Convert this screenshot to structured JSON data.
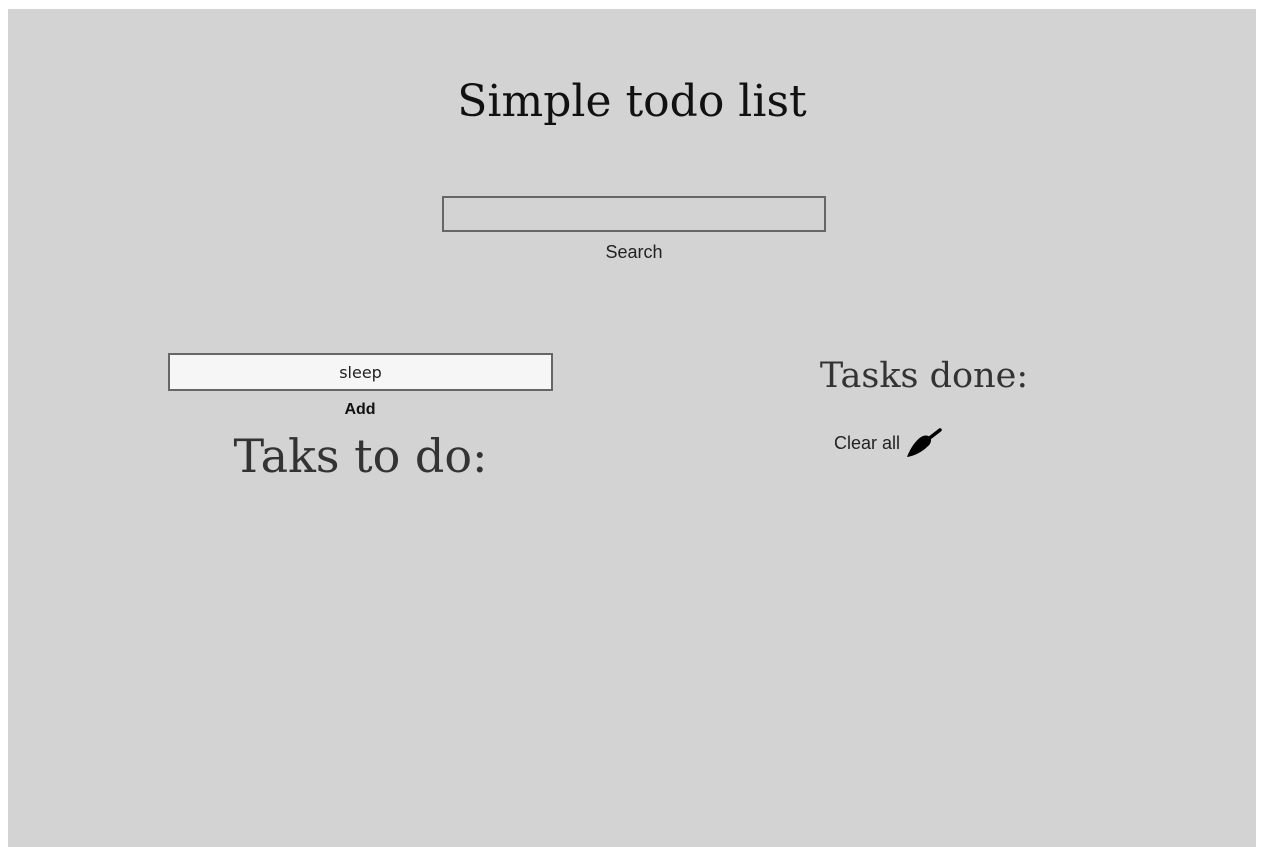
{
  "app": {
    "title": "Simple todo list"
  },
  "search": {
    "value": "",
    "placeholder": "",
    "button_label": "Search"
  },
  "add": {
    "value": "sleep",
    "placeholder": "",
    "button_label": "Add"
  },
  "todo": {
    "heading": "Taks to do:",
    "items": []
  },
  "done": {
    "heading": "Tasks done:",
    "clear_label": "Clear all",
    "clear_icon": "broom-icon",
    "items": []
  },
  "colors": {
    "background": "#d3d3d3",
    "input_border": "#666666",
    "text": "#222222"
  }
}
